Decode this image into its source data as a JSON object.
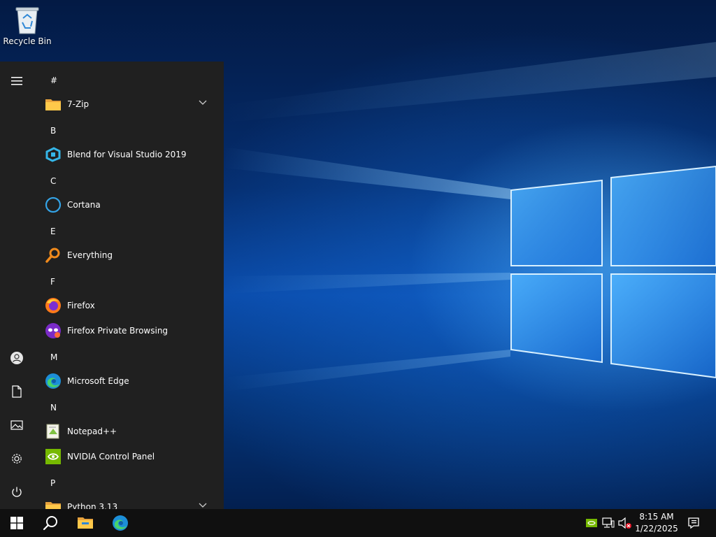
{
  "desktop": {
    "recycle_bin_label": "Recycle Bin"
  },
  "start_menu": {
    "rail": {
      "menu_icon": "hamburger-icon",
      "items": [
        {
          "icon": "user-icon"
        },
        {
          "icon": "documents-icon"
        },
        {
          "icon": "pictures-icon"
        },
        {
          "icon": "settings-icon"
        },
        {
          "icon": "power-icon"
        }
      ]
    },
    "apps": {
      "letter_hash": "#",
      "seven_zip": "7-Zip",
      "letter_b": "B",
      "blend": "Blend for Visual Studio 2019",
      "letter_c": "C",
      "cortana": "Cortana",
      "letter_e": "E",
      "everything": "Everything",
      "letter_f": "F",
      "firefox": "Firefox",
      "firefox_private": "Firefox Private Browsing",
      "letter_m": "M",
      "edge": "Microsoft Edge",
      "letter_n": "N",
      "notepadpp": "Notepad++",
      "nvidia": "NVIDIA Control Panel",
      "letter_p": "P",
      "python": "Python 3.13"
    }
  },
  "taskbar": {
    "start_icon": "windows-logo-icon",
    "search_icon": "search-icon",
    "pinned": [
      {
        "icon": "file-explorer-icon"
      },
      {
        "icon": "edge-icon"
      }
    ],
    "tray": {
      "icons": [
        "nvidia-icon",
        "network-icon",
        "volume-muted-icon"
      ],
      "time": "8:15 AM",
      "date": "1/22/2025",
      "notification_icon": "action-center-icon"
    }
  },
  "colors": {
    "start_bg": "#202020",
    "taskbar_bg": "#101010",
    "accent_blue": "#0078d7"
  }
}
